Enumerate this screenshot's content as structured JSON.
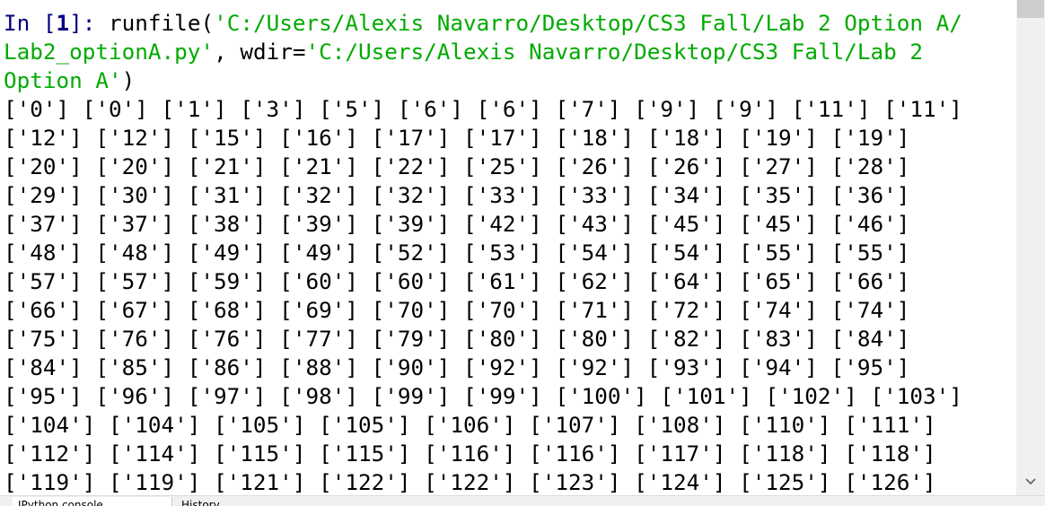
{
  "console": {
    "prompt_label": "In [",
    "prompt_number": "1",
    "prompt_suffix": "]: ",
    "cmd_func": "runfile(",
    "cmd_arg1": "'C:/Users/Alexis Navarro/Desktop/CS3 Fall/Lab 2 Option A/\nLab2_optionA.py'",
    "cmd_sep": ", wdir=",
    "cmd_arg2": "'C:/Users/Alexis Navarro/Desktop/CS3 Fall/Lab 2\nOption A'",
    "cmd_end": ")",
    "output_lines": [
      "['0'] ['0'] ['1'] ['3'] ['5'] ['6'] ['6'] ['7'] ['9'] ['9'] ['11'] ['11']",
      "['12'] ['12'] ['15'] ['16'] ['17'] ['17'] ['18'] ['18'] ['19'] ['19']",
      "['20'] ['20'] ['21'] ['21'] ['22'] ['25'] ['26'] ['26'] ['27'] ['28']",
      "['29'] ['30'] ['31'] ['32'] ['32'] ['33'] ['33'] ['34'] ['35'] ['36']",
      "['37'] ['37'] ['38'] ['39'] ['39'] ['42'] ['43'] ['45'] ['45'] ['46']",
      "['48'] ['48'] ['49'] ['49'] ['52'] ['53'] ['54'] ['54'] ['55'] ['55']",
      "['57'] ['57'] ['59'] ['60'] ['60'] ['61'] ['62'] ['64'] ['65'] ['66']",
      "['66'] ['67'] ['68'] ['69'] ['70'] ['70'] ['71'] ['72'] ['74'] ['74']",
      "['75'] ['76'] ['76'] ['77'] ['79'] ['80'] ['80'] ['82'] ['83'] ['84']",
      "['84'] ['85'] ['86'] ['88'] ['90'] ['92'] ['92'] ['93'] ['94'] ['95']",
      "['95'] ['96'] ['97'] ['98'] ['99'] ['99'] ['100'] ['101'] ['102'] ['103']",
      "['104'] ['104'] ['105'] ['105'] ['106'] ['107'] ['108'] ['110'] ['111']",
      "['112'] ['114'] ['115'] ['115'] ['116'] ['116'] ['117'] ['118'] ['118']",
      "['119'] ['119'] ['121'] ['122'] ['122'] ['123'] ['124'] ['125'] ['126']"
    ]
  },
  "tabs": {
    "console_label": "IPython console",
    "history_label": "History"
  },
  "icons": {
    "scroll_down": "chevron-down-icon"
  },
  "colors": {
    "prompt": "#000080",
    "string": "#00aa00",
    "text": "#000000",
    "background": "#ffffff"
  }
}
